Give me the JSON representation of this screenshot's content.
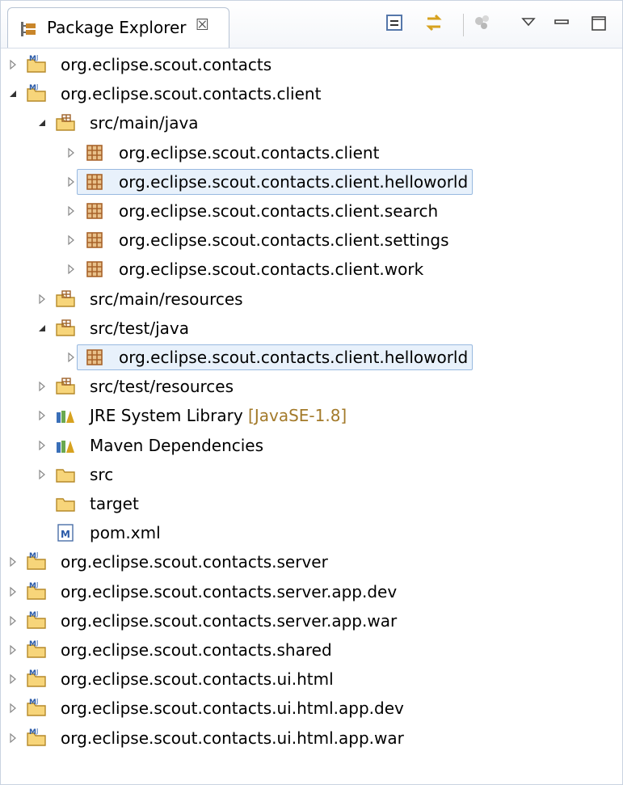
{
  "view": {
    "title": "Package Explorer",
    "close_glyph": "☒",
    "toolbar": [
      "collapse-all-icon",
      "link-with-editor-icon",
      "focus-on-active-task-icon",
      "view-menu-icon",
      "minimize-icon",
      "maximize-icon"
    ]
  },
  "tree": [
    {
      "label": "org.eclipse.scout.contacts",
      "icon": "maven-project-icon",
      "expanded": false
    },
    {
      "label": "org.eclipse.scout.contacts.client",
      "icon": "maven-project-icon",
      "expanded": true
    },
    {
      "label": "src/main/java",
      "icon": "source-folder-icon",
      "expanded": true
    },
    {
      "label": "org.eclipse.scout.contacts.client",
      "icon": "package-icon",
      "expanded": false
    },
    {
      "label": "org.eclipse.scout.contacts.client.helloworld",
      "icon": "package-icon",
      "expanded": false,
      "selected": true
    },
    {
      "label": "org.eclipse.scout.contacts.client.search",
      "icon": "package-icon",
      "expanded": false
    },
    {
      "label": "org.eclipse.scout.contacts.client.settings",
      "icon": "package-icon",
      "expanded": false
    },
    {
      "label": "org.eclipse.scout.contacts.client.work",
      "icon": "package-icon",
      "expanded": false
    },
    {
      "label": "src/main/resources",
      "icon": "source-folder-icon",
      "expanded": false
    },
    {
      "label": "src/test/java",
      "icon": "source-folder-icon",
      "expanded": true
    },
    {
      "label": "org.eclipse.scout.contacts.client.helloworld",
      "icon": "package-icon",
      "expanded": false,
      "selected": true
    },
    {
      "label": "src/test/resources",
      "icon": "source-folder-icon",
      "expanded": false
    },
    {
      "label": "JRE System Library",
      "decoration": "[JavaSE-1.8]",
      "icon": "library-icon",
      "expanded": false
    },
    {
      "label": "Maven Dependencies",
      "icon": "library-icon",
      "expanded": false
    },
    {
      "label": "src",
      "icon": "folder-icon",
      "expanded": false
    },
    {
      "label": "target",
      "icon": "folder-icon"
    },
    {
      "label": "pom.xml",
      "icon": "maven-pom-file-icon"
    },
    {
      "label": "org.eclipse.scout.contacts.server",
      "icon": "maven-project-icon",
      "expanded": false
    },
    {
      "label": "org.eclipse.scout.contacts.server.app.dev",
      "icon": "maven-project-icon",
      "expanded": false
    },
    {
      "label": "org.eclipse.scout.contacts.server.app.war",
      "icon": "maven-project-icon",
      "expanded": false
    },
    {
      "label": "org.eclipse.scout.contacts.shared",
      "icon": "maven-project-icon",
      "expanded": false
    },
    {
      "label": "org.eclipse.scout.contacts.ui.html",
      "icon": "maven-project-icon",
      "expanded": false
    },
    {
      "label": "org.eclipse.scout.contacts.ui.html.app.dev",
      "icon": "maven-project-icon",
      "expanded": false
    },
    {
      "label": "org.eclipse.scout.contacts.ui.html.app.war",
      "icon": "maven-project-icon",
      "expanded": false
    }
  ]
}
